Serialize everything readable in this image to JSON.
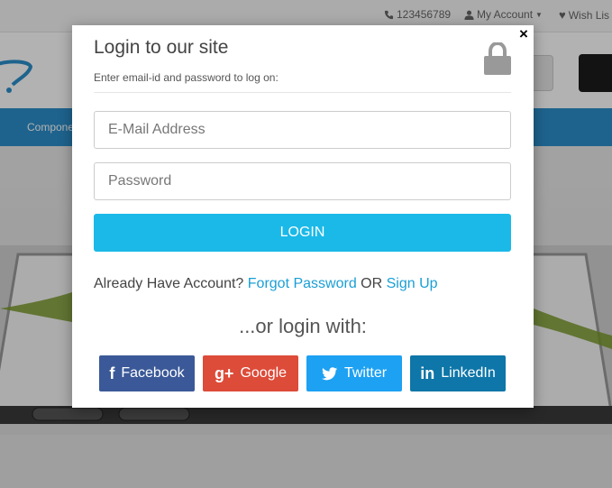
{
  "topbar": {
    "phone": "123456789",
    "account": "My Account",
    "wishlist": "Wish Lis"
  },
  "nav": {
    "item": "Compone"
  },
  "modal": {
    "title": "Login to our site",
    "subtitle": "Enter email-id and password to log on:",
    "email_placeholder": "E-Mail Address",
    "password_placeholder": "Password",
    "login_label": "LOGIN",
    "account_text": "Already Have Account?",
    "forgot_label": "Forgot Password",
    "or_text": "OR",
    "signup_label": "Sign Up",
    "or_login_with": "...or login with:",
    "close": "×"
  },
  "social": {
    "facebook": "Facebook",
    "google": "Google",
    "twitter": "Twitter",
    "linkedin": "LinkedIn"
  },
  "colors": {
    "accent": "#1ab9e8",
    "link": "#1a9fd6",
    "facebook": "#3b5998",
    "google": "#dd4b39",
    "twitter": "#1da1f2",
    "linkedin": "#0e76a8"
  }
}
